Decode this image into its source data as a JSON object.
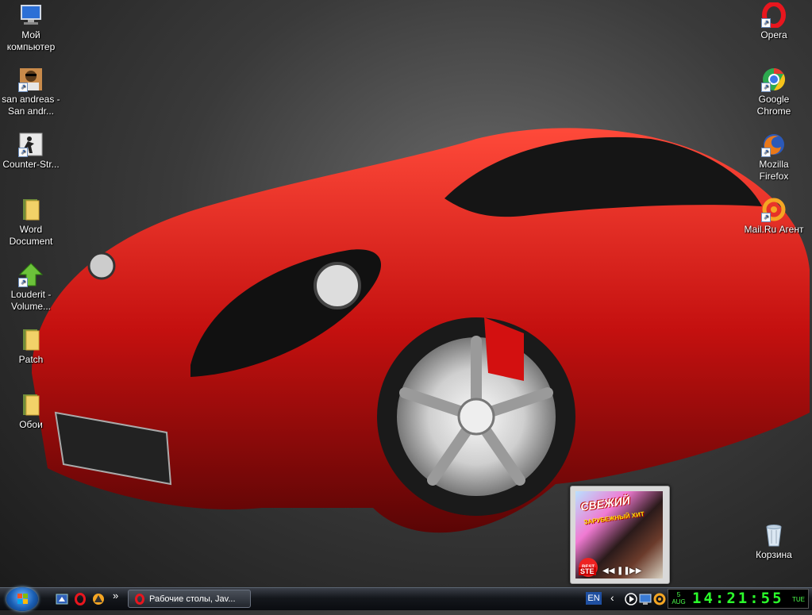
{
  "desktop_icons_left": [
    {
      "label": "Мой компьютер",
      "icon": "computer-icon",
      "shortcut": false
    },
    {
      "label": "san andreas - San andr...",
      "icon": "gta-san-andreas-icon",
      "shortcut": true
    },
    {
      "label": "Counter-Str...",
      "icon": "counter-strike-icon",
      "shortcut": true
    },
    {
      "label": "Word Document",
      "icon": "folder-icon",
      "shortcut": false
    },
    {
      "label": "Louderit - Volume...",
      "icon": "louderit-icon",
      "shortcut": true
    },
    {
      "label": "Patch",
      "icon": "folder-icon",
      "shortcut": false
    },
    {
      "label": "Обои",
      "icon": "folder-icon",
      "shortcut": false
    }
  ],
  "desktop_icons_right": [
    {
      "label": "Opera",
      "icon": "opera-icon",
      "shortcut": true
    },
    {
      "label": "Google Chrome",
      "icon": "chrome-icon",
      "shortcut": true
    },
    {
      "label": "Mozilla Firefox",
      "icon": "firefox-icon",
      "shortcut": true
    },
    {
      "label": "Mail.Ru Агент",
      "icon": "mail-ru-agent-icon",
      "shortcut": true
    },
    {
      "label": "Корзина",
      "icon": "recycle-bin-icon",
      "shortcut": false
    }
  ],
  "taskbar": {
    "quicklaunch": [
      "media-icon",
      "opera-icon",
      "aimp-icon"
    ],
    "overflow_glyph": "»",
    "active_task": "Рабочие столы, Jav...",
    "language": "EN",
    "tray_icons": [
      "chevron-left-icon",
      "play-icon",
      "network-icon",
      "mail-ru-agent-icon"
    ],
    "clock": {
      "day": "5",
      "month": "AUG",
      "time": "14:21:55",
      "weekday": "TUE"
    }
  },
  "player_widget": {
    "cover_title": "СВЕЖИЙ",
    "cover_subtitle": "ЗАРУБЕЖНЫЙ ХИТ",
    "badge": "BEST",
    "label": "STE",
    "controls": [
      "prev-icon",
      "pause-icon",
      "next-icon"
    ]
  },
  "colors": {
    "wallpaper_car": "#c4100f",
    "clock_digits": "#2bff2b",
    "taskbar": "#14171c"
  }
}
